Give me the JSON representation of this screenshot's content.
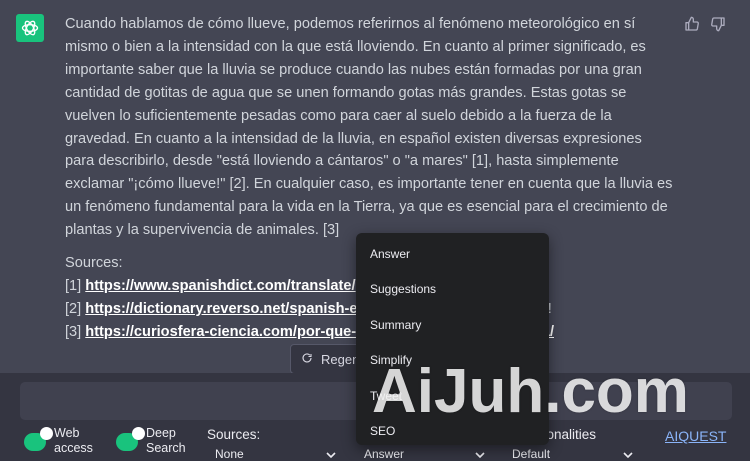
{
  "message": {
    "paragraph": "Cuando hablamos de cómo llueve, podemos referirnos al fenómeno meteorológico en sí mismo o bien a la intensidad con la que está lloviendo. En cuanto al primer significado, es importante saber que la lluvia se produce cuando las nubes están formadas por una gran cantidad de gotitas de agua que se unen formando gotas más grandes. Estas gotas se vuelven lo suficientemente pesadas como para caer al suelo debido a la fuerza de la gravedad. En cuanto a la intensidad de la lluvia, en español existen diversas expresiones para describirlo, desde \"está lloviendo a cántaros\" o \"a mares\" [1], hasta simplemente exclamar \"¡cómo llueve!\" [2]. En cualquier caso, es importante tener en cuenta que la lluvia es un fenómeno fundamental para la vida en la Tierra, ya que es esencial para el crecimiento de plantas y la supervivencia de animales. [3]",
    "sources_label": "Sources:",
    "sources": [
      {
        "num": "[1] ",
        "link_text": "https://www.spanishdict.com/translate/",
        "suffix": ""
      },
      {
        "num": "[2] ",
        "link_text": "https://dictionary.reverso.net/spanish-english/c%C3%B3mo+llueve",
        "suffix": "!"
      },
      {
        "num": "[3] ",
        "link_text": "https://curiosfera-ciencia.com/por-que-llueve-como-se-forma-lluvia/",
        "suffix": ""
      }
    ]
  },
  "regenerate": {
    "label": "Regenerate response"
  },
  "toolbar": {
    "web_access_line1": "Web",
    "web_access_line2": "access",
    "deep_search_line1": "Deep",
    "deep_search_line2": "Search",
    "sources_label": "Sources:",
    "sources_value": "None",
    "mode_value": "Answer",
    "personalities_label": "Personalities:",
    "personalities_value": "Default",
    "aiquest_link": "AIQUEST"
  },
  "menu": {
    "items": [
      "Answer",
      "Suggestions",
      "Summary",
      "Simplify",
      "Tweet",
      "SEO"
    ]
  },
  "watermark": {
    "text": "AiJuh.com"
  },
  "colors": {
    "accent": "#19c37d",
    "background": "#444654",
    "footer": "#343541",
    "menu": "#202123"
  }
}
